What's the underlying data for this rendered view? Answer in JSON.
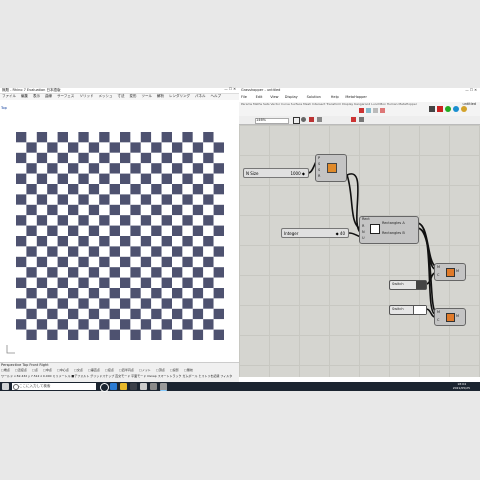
{
  "rhino": {
    "title": "無題 - Rhino 7 Evaluation 日本語版",
    "menu": [
      "ファイル",
      "編集",
      "表示",
      "曲線",
      "サーフェス",
      "ソリッド",
      "メッシュ",
      "寸法",
      "変形",
      "ツール",
      "解析",
      "レンダリング",
      "パネル",
      "ヘルプ"
    ],
    "viewport_label": "Top",
    "status_row1": "Perspective  Top  Front  Right",
    "status_row2": [
      "端点",
      "近接点",
      "点",
      "中点",
      "中心点",
      "交点",
      "垂直点",
      "接点",
      "四半円点",
      "ノット",
      "頂点",
      "投影",
      "無効"
    ],
    "status_row3": "ワールド  x 82.432  y 7.512  z 0.000  ミリメートル  ■デフォルト  グリッドスナップ  直交モード  平面モード  Osnap  スマートトラック  ガムボール  ヒストリを記録  フィルタ"
  },
  "gh": {
    "title": "Grasshopper - untitled",
    "menu": [
      "File",
      "Edit",
      "View",
      "Display",
      "Solution",
      "Help",
      "MetaHopper"
    ],
    "tabs": [
      "Params",
      "Maths",
      "Sets",
      "Vector",
      "Curve",
      "Surface",
      "Mesh",
      "Intersect",
      "Transform",
      "Display",
      "Kangaroo2",
      "LunchBox",
      "Human",
      "MetaHopper"
    ],
    "right_label": "untitled",
    "zoom": "146%",
    "nodes": {
      "slider1": {
        "label": "N Size",
        "value": "1000 ◆"
      },
      "slider2": {
        "label": "Integer",
        "value": "◆ 40"
      },
      "rect_params_in": [
        "P",
        "S",
        "S",
        "R"
      ],
      "rect_component": {
        "name": "Rect",
        "outA": "Rectangles A",
        "outB": "Rectangles B",
        "inputs": [
          "R",
          "N",
          "U"
        ]
      },
      "toggle1": {
        "label": "Switch"
      },
      "toggle2": {
        "label": "Switch"
      },
      "preview_in": [
        "M",
        "C"
      ],
      "preview_out": "M"
    }
  },
  "taskbar": {
    "search_placeholder": "ここに入力して検索",
    "time": "18:04",
    "date": "2021/05/25"
  },
  "colors": {
    "checker_dark": "#4e5270",
    "checker_light": "#ffffff",
    "canvas": "#d5d5d0",
    "taskbar": "#1b2430"
  }
}
